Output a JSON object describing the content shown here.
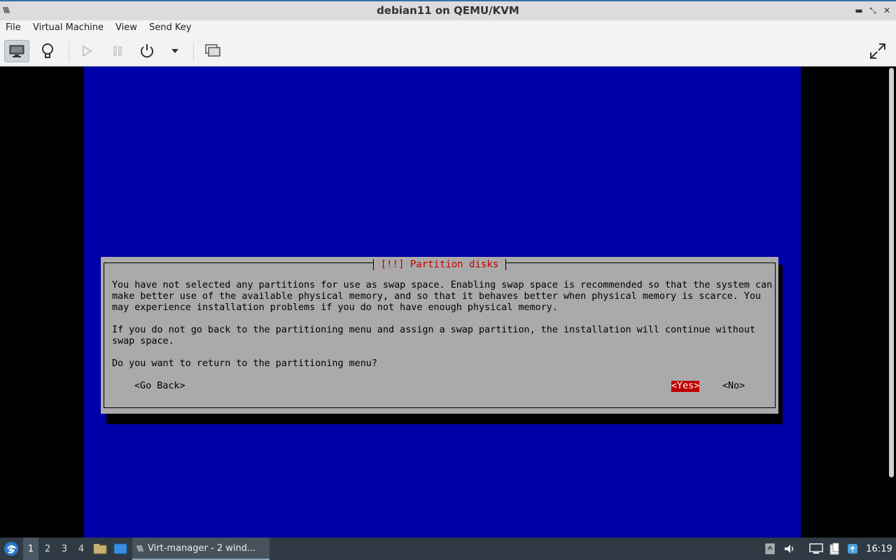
{
  "window": {
    "title": "debian11 on QEMU/KVM",
    "app_icon": "virt-manager-icon"
  },
  "menu": [
    "File",
    "Virtual Machine",
    "View",
    "Send Key"
  ],
  "toolbar": {
    "buttons": [
      "console-icon",
      "details-lightbulb-icon",
      "run-icon",
      "pause-icon",
      "power-icon",
      "dropdown-arrow-icon",
      "snapshots-icon",
      "fullscreen-icon"
    ]
  },
  "installer": {
    "dialog_title": "[!!] Partition disks",
    "paragraph1": [
      "You have not selected any partitions for use as swap space. Enabling swap space is recommended so that the system can",
      "make better use of the available physical memory, and so that it behaves better when physical memory is scarce. You",
      "may experience installation problems if you do not have enough physical memory."
    ],
    "paragraph2": [
      "If you do not go back to the partitioning menu and assign a swap partition, the installation will continue without",
      "swap space."
    ],
    "question": "Do you want to return to the partitioning menu?",
    "go_back": "<Go Back>",
    "yes": "<Yes>",
    "no": "<No>"
  },
  "taskbar": {
    "workspaces": [
      "1",
      "2",
      "3",
      "4"
    ],
    "task_label": "Virt-manager - 2 wind...",
    "clock": "16:19"
  },
  "colors": {
    "installer_bg": "#0000a8",
    "dialog_bg": "#aaaaaa",
    "accent_red": "#c00000",
    "taskbar_bg": "#2f3a44"
  }
}
